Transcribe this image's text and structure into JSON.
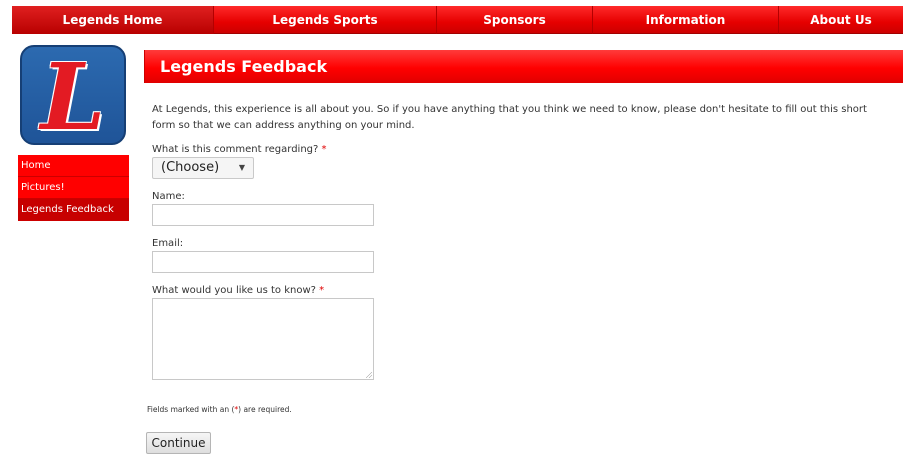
{
  "topnav": {
    "items": [
      {
        "label": "Legends Home"
      },
      {
        "label": "Legends Sports"
      },
      {
        "label": "Sponsors"
      },
      {
        "label": "Information"
      },
      {
        "label": "About Us"
      }
    ]
  },
  "logo": {
    "letter": "L"
  },
  "sidebar": {
    "items": [
      {
        "label": "Home"
      },
      {
        "label": "Pictures!"
      },
      {
        "label": "Legends Feedback"
      }
    ]
  },
  "page": {
    "title": "Legends Feedback",
    "intro": "At Legends, this experience is all about you. So if you have anything that you think we need to know, please don't hesitate to fill out this short form so that we can address anything on your mind."
  },
  "form": {
    "topic_label": "What is this comment regarding?",
    "required_mark": "*",
    "topic_value": "(Choose)",
    "name_label": "Name:",
    "email_label": "Email:",
    "message_label": "What would you like us to know?",
    "required_note_pre": "Fields marked with an (",
    "required_note_post": ") are required.",
    "submit_label": "Continue"
  },
  "colors": {
    "brand_red": "#ff0000",
    "logo_blue": "#1f5498"
  }
}
